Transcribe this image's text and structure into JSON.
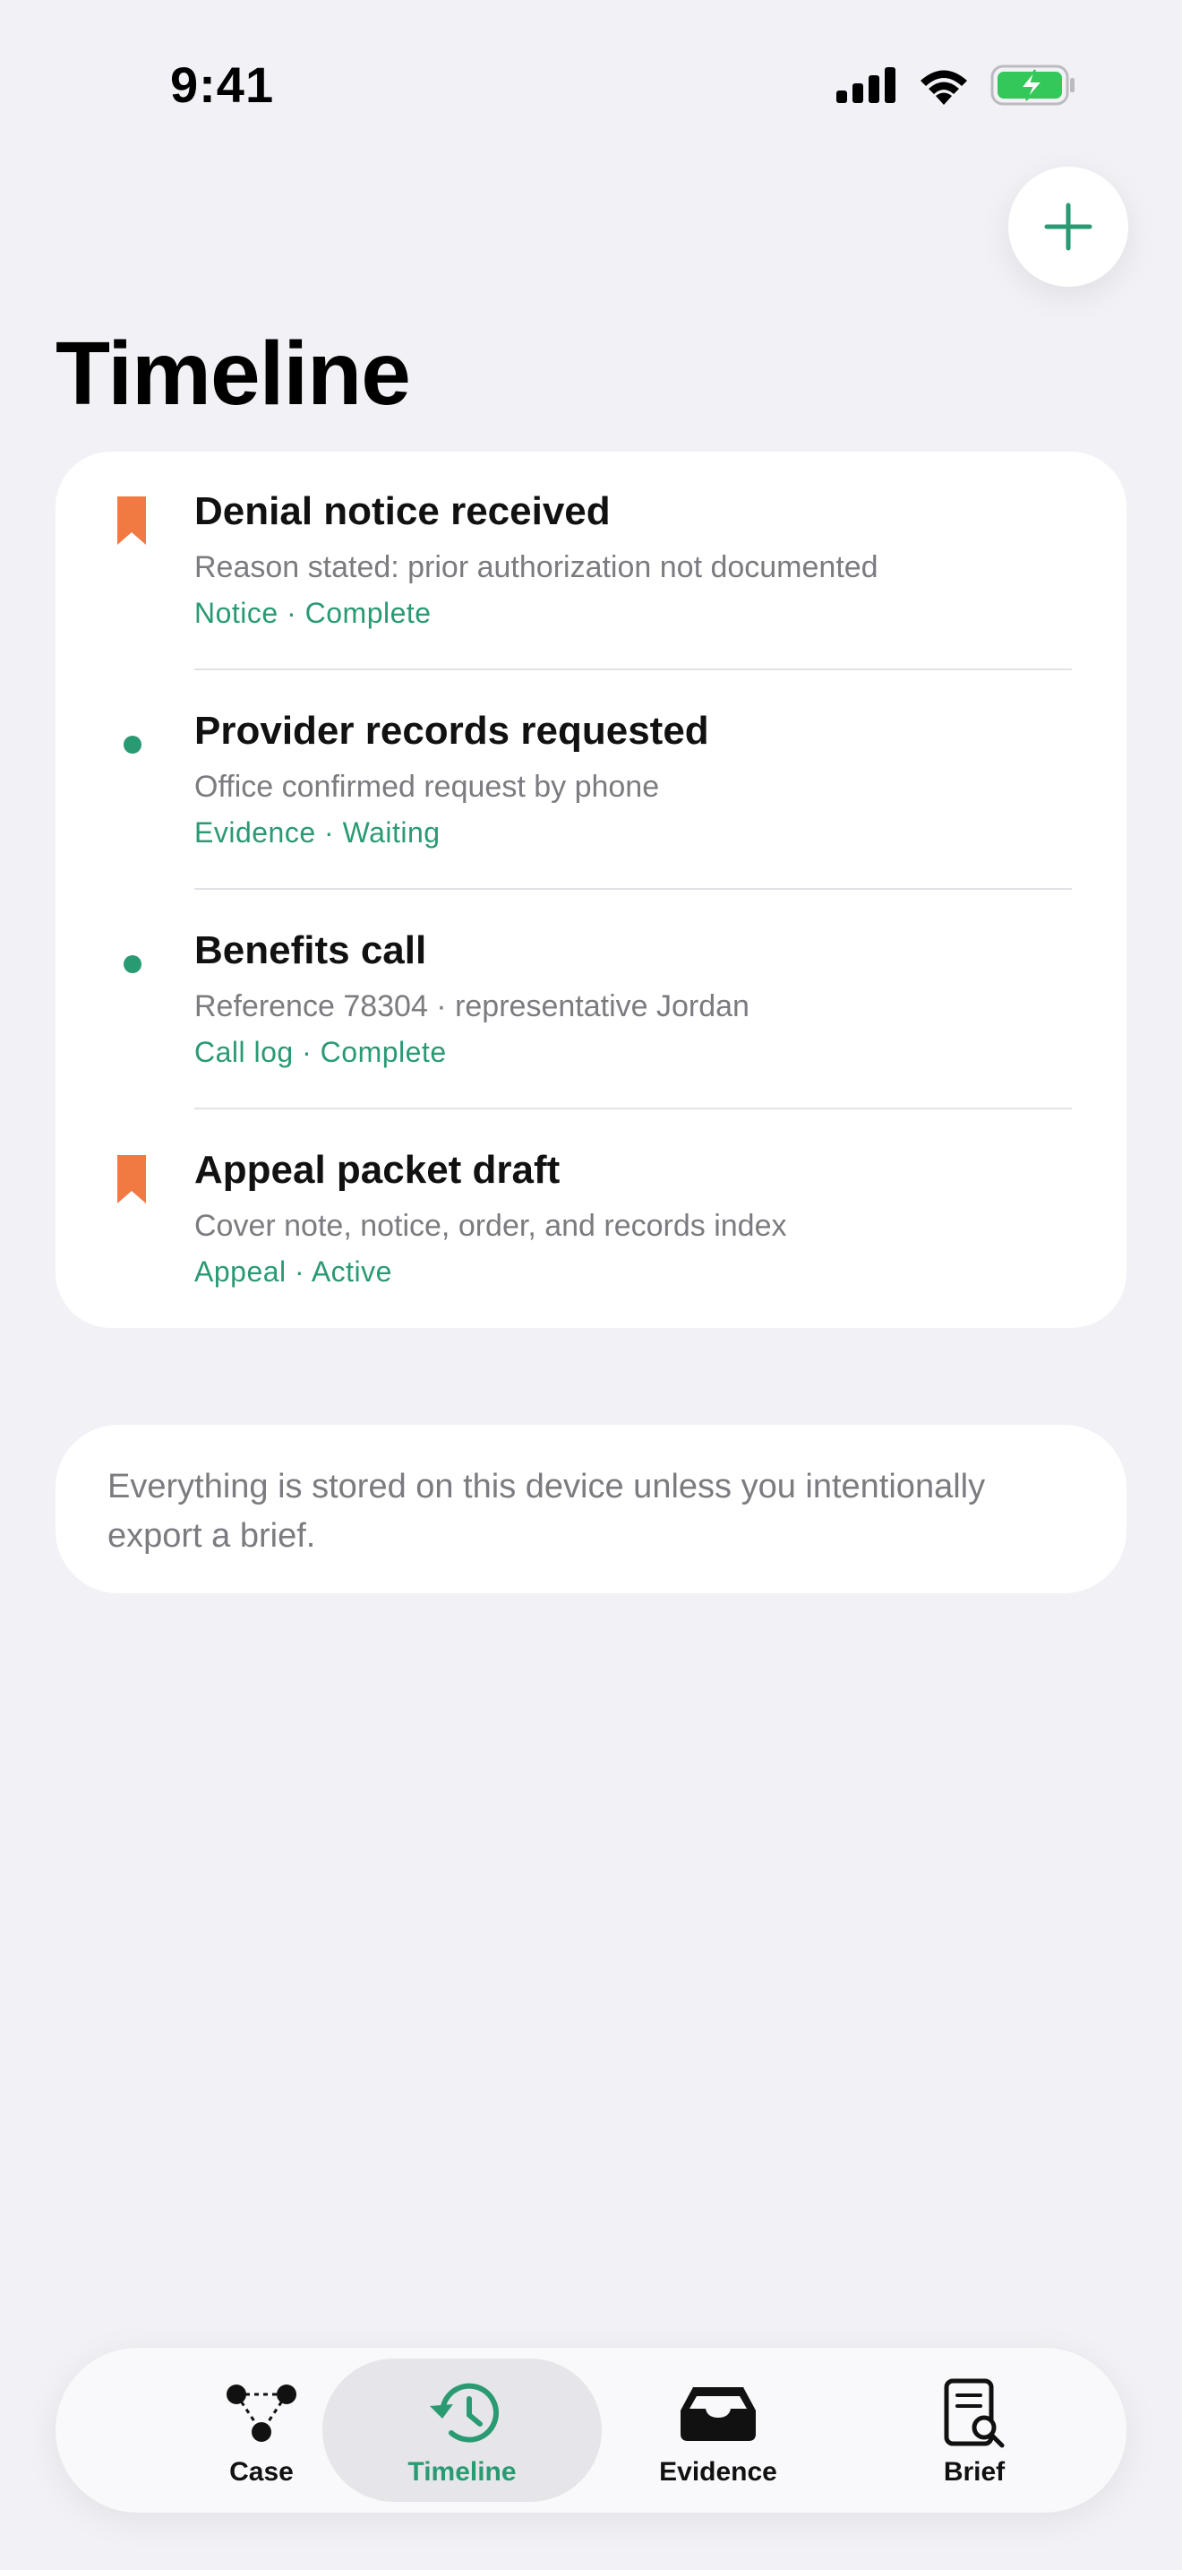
{
  "status_bar": {
    "time": "9:41"
  },
  "page": {
    "title": "Timeline"
  },
  "colors": {
    "accent": "#2a9a72",
    "bookmark": "#f07a42",
    "background": "#f2f1f6"
  },
  "timeline": [
    {
      "marker": "bookmark-icon",
      "title": "Denial notice received",
      "subtitle": "Reason stated: prior authorization not documented",
      "meta": "Notice · Complete"
    },
    {
      "marker": "dot-icon",
      "title": "Provider records requested",
      "subtitle": "Office confirmed request by phone",
      "meta": "Evidence · Waiting"
    },
    {
      "marker": "dot-icon",
      "title": "Benefits call",
      "subtitle": "Reference 78304 · representative Jordan",
      "meta": "Call log · Complete"
    },
    {
      "marker": "bookmark-icon",
      "title": "Appeal packet draft",
      "subtitle": "Cover note, notice, order, and records index",
      "meta": "Appeal · Active"
    }
  ],
  "info": {
    "text": "Everything is stored on this device unless you intentionally export a brief."
  },
  "tabs": [
    {
      "label": "Case",
      "icon": "case-graph-icon",
      "active": false
    },
    {
      "label": "Timeline",
      "icon": "history-icon",
      "active": true
    },
    {
      "label": "Evidence",
      "icon": "tray-icon",
      "active": false
    },
    {
      "label": "Brief",
      "icon": "document-search-icon",
      "active": false
    }
  ]
}
